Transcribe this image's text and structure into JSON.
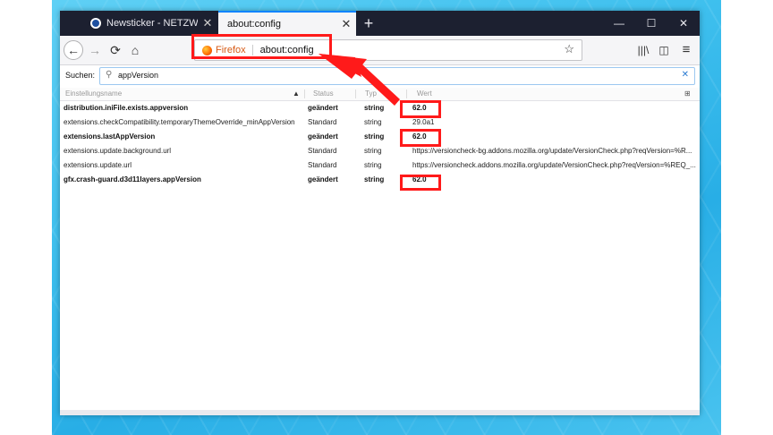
{
  "browser": {
    "tabs": [
      {
        "label": "Newsticker - NETZWELT",
        "active": false
      },
      {
        "label": "about:config",
        "active": true
      }
    ],
    "new_tab": "+",
    "window_controls": {
      "minimize": "—",
      "maximize": "☐",
      "close": "✕"
    }
  },
  "navbar": {
    "back": "←",
    "forward": "→",
    "reload": "⟳",
    "home": "⌂",
    "identity_label": "Firefox",
    "url": "about:config",
    "bookmark_star": "☆",
    "library": "|||\\",
    "sidebar": "◫",
    "menu": "≡"
  },
  "search": {
    "label": "Suchen:",
    "icon": "⚲",
    "value": "appVersion",
    "clear": "✕"
  },
  "table": {
    "columns": [
      "Einstellungsname",
      "Status",
      "Typ",
      "Wert"
    ],
    "sort_indicator": "▲",
    "column_picker": "⊞",
    "rows": [
      {
        "name": "distribution.iniFile.exists.appversion",
        "status": "geändert",
        "type": "string",
        "value": "62.0",
        "modified": true
      },
      {
        "name": "extensions.checkCompatibility.temporaryThemeOverride_minAppVersion",
        "status": "Standard",
        "type": "string",
        "value": "29.0a1",
        "modified": false
      },
      {
        "name": "extensions.lastAppVersion",
        "status": "geändert",
        "type": "string",
        "value": "62.0",
        "modified": true
      },
      {
        "name": "extensions.update.background.url",
        "status": "Standard",
        "type": "string",
        "value": "https://versioncheck-bg.addons.mozilla.org/update/VersionCheck.php?reqVersion=%R...",
        "modified": false
      },
      {
        "name": "extensions.update.url",
        "status": "Standard",
        "type": "string",
        "value": "https://versioncheck.addons.mozilla.org/update/VersionCheck.php?reqVersion=%REQ_...",
        "modified": false
      },
      {
        "name": "gfx.crash-guard.d3d11layers.appVersion",
        "status": "geändert",
        "type": "string",
        "value": "62.0",
        "modified": true
      }
    ]
  },
  "annotation_color": "#ff1a1a"
}
